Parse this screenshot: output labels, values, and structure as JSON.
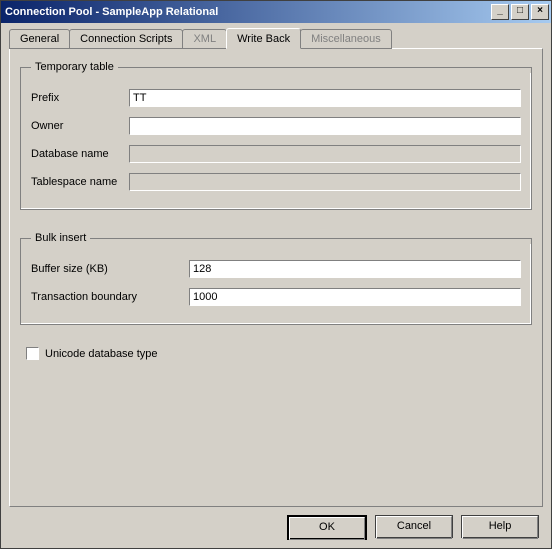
{
  "window": {
    "title": "Connection Pool - SampleApp Relational"
  },
  "tabs": [
    {
      "label": "General",
      "state": "normal"
    },
    {
      "label": "Connection Scripts",
      "state": "normal"
    },
    {
      "label": "XML",
      "state": "disabled"
    },
    {
      "label": "Write Back",
      "state": "active"
    },
    {
      "label": "Miscellaneous",
      "state": "disabled"
    }
  ],
  "temp_table": {
    "legend": "Temporary table",
    "prefix_label": "Prefix",
    "prefix_value": "TT",
    "owner_label": "Owner",
    "owner_value": "",
    "dbname_label": "Database name",
    "dbname_value": "",
    "tsname_label": "Tablespace name",
    "tsname_value": ""
  },
  "bulk_insert": {
    "legend": "Bulk insert",
    "buffer_label": "Buffer size (KB)",
    "buffer_value": "128",
    "txn_label": "Transaction boundary",
    "txn_value": "1000"
  },
  "unicode_label": "Unicode database type",
  "buttons": {
    "ok": "OK",
    "cancel": "Cancel",
    "help": "Help"
  }
}
